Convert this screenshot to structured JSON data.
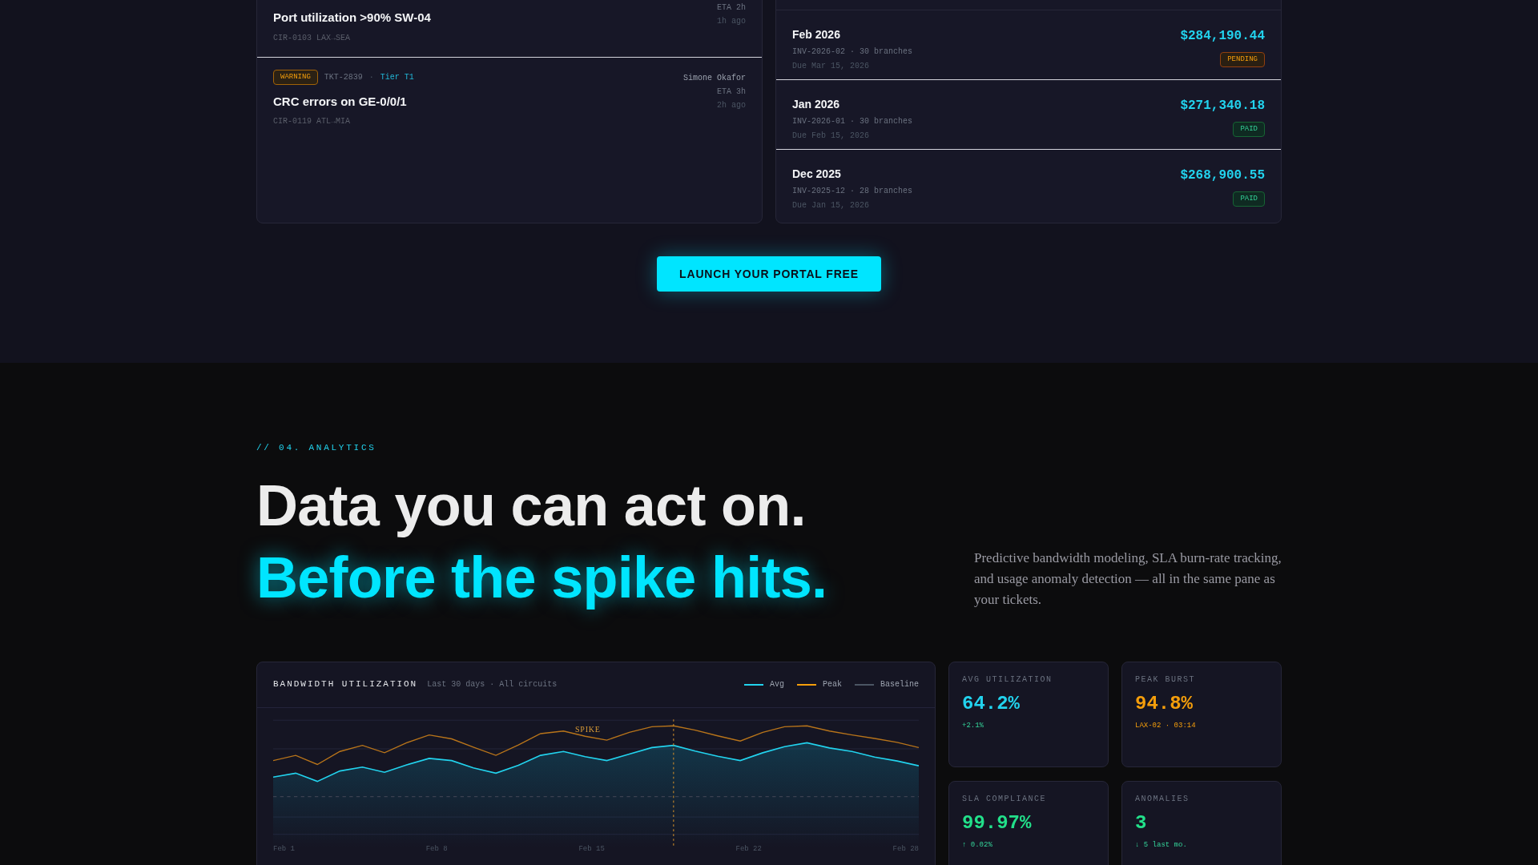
{
  "tickets": [
    {
      "title": "Port utilization >90% SW-04",
      "circuit": "CIR-0103 LAX→SEA",
      "eta": "ETA 2h",
      "age": "1h ago"
    },
    {
      "kind": "warning",
      "badge": "WARNING",
      "id": "TKT-2839",
      "separator": "·",
      "tier": "Tier T1",
      "assignee": "Simone Okafor",
      "title": "CRC errors on GE-0/0/1",
      "circuit": "CIR-0119 ATL→MIA",
      "eta": "ETA 3h",
      "age": "2h ago"
    }
  ],
  "invoices": [
    {
      "period": "Feb 2026",
      "meta": "INV-2026-02 · 30 branches",
      "due": "Due Mar 15, 2026",
      "amount": "$284,190.44",
      "kind": "pending",
      "badge": "PENDING"
    },
    {
      "period": "Jan 2026",
      "meta": "INV-2026-01 · 30 branches",
      "due": "Due Feb 15, 2026",
      "amount": "$271,340.18",
      "kind": "paid",
      "badge": "PAID"
    },
    {
      "period": "Dec 2025",
      "meta": "INV-2025-12 · 28 branches",
      "due": "Due Jan 15, 2026",
      "amount": "$268,900.55",
      "kind": "paid",
      "badge": "PAID"
    }
  ],
  "cta_button": "LAUNCH YOUR PORTAL FREE",
  "analytics": {
    "eyebrow": "// 04. ANALYTICS",
    "heading": "Data you can act on.",
    "heading_accent": "Before the spike hits.",
    "description": "Predictive bandwidth modeling, SLA burn-rate tracking, and usage anomaly detection — all in the same pane as your tickets."
  },
  "chart": {
    "title": "BANDWIDTH UTILIZATION",
    "subtitle": "Last 30 days · All circuits",
    "legend": [
      {
        "label": "Avg",
        "color": "#22d3ee"
      },
      {
        "label": "Peak",
        "color": "#f59e0b"
      },
      {
        "label": "Baseline",
        "color": "#4b5563"
      }
    ],
    "marker": "SPIKE",
    "x_labels": [
      "Feb 1",
      "Feb 8",
      "Feb 15",
      "Feb 22",
      "Feb 28"
    ]
  },
  "stats": [
    {
      "label": "AVG UTILIZATION",
      "value": "64.2%",
      "note": "+2.1%",
      "color": "#22d3ee",
      "kind": "delta"
    },
    {
      "label": "PEAK BURST",
      "value": "94.8%",
      "note": "LAX-02 · 03:14",
      "color": "#f59e0b",
      "kind": "detail"
    },
    {
      "label": "SLA COMPLIANCE",
      "value": "99.97%",
      "note": "↑ 0.02%",
      "color": "#22e08a",
      "kind": "delta"
    },
    {
      "label": "ANOMALIES",
      "value": "3",
      "note": "↓ 5 last mo.",
      "color": "#22e08a",
      "kind": "delta"
    }
  ]
}
